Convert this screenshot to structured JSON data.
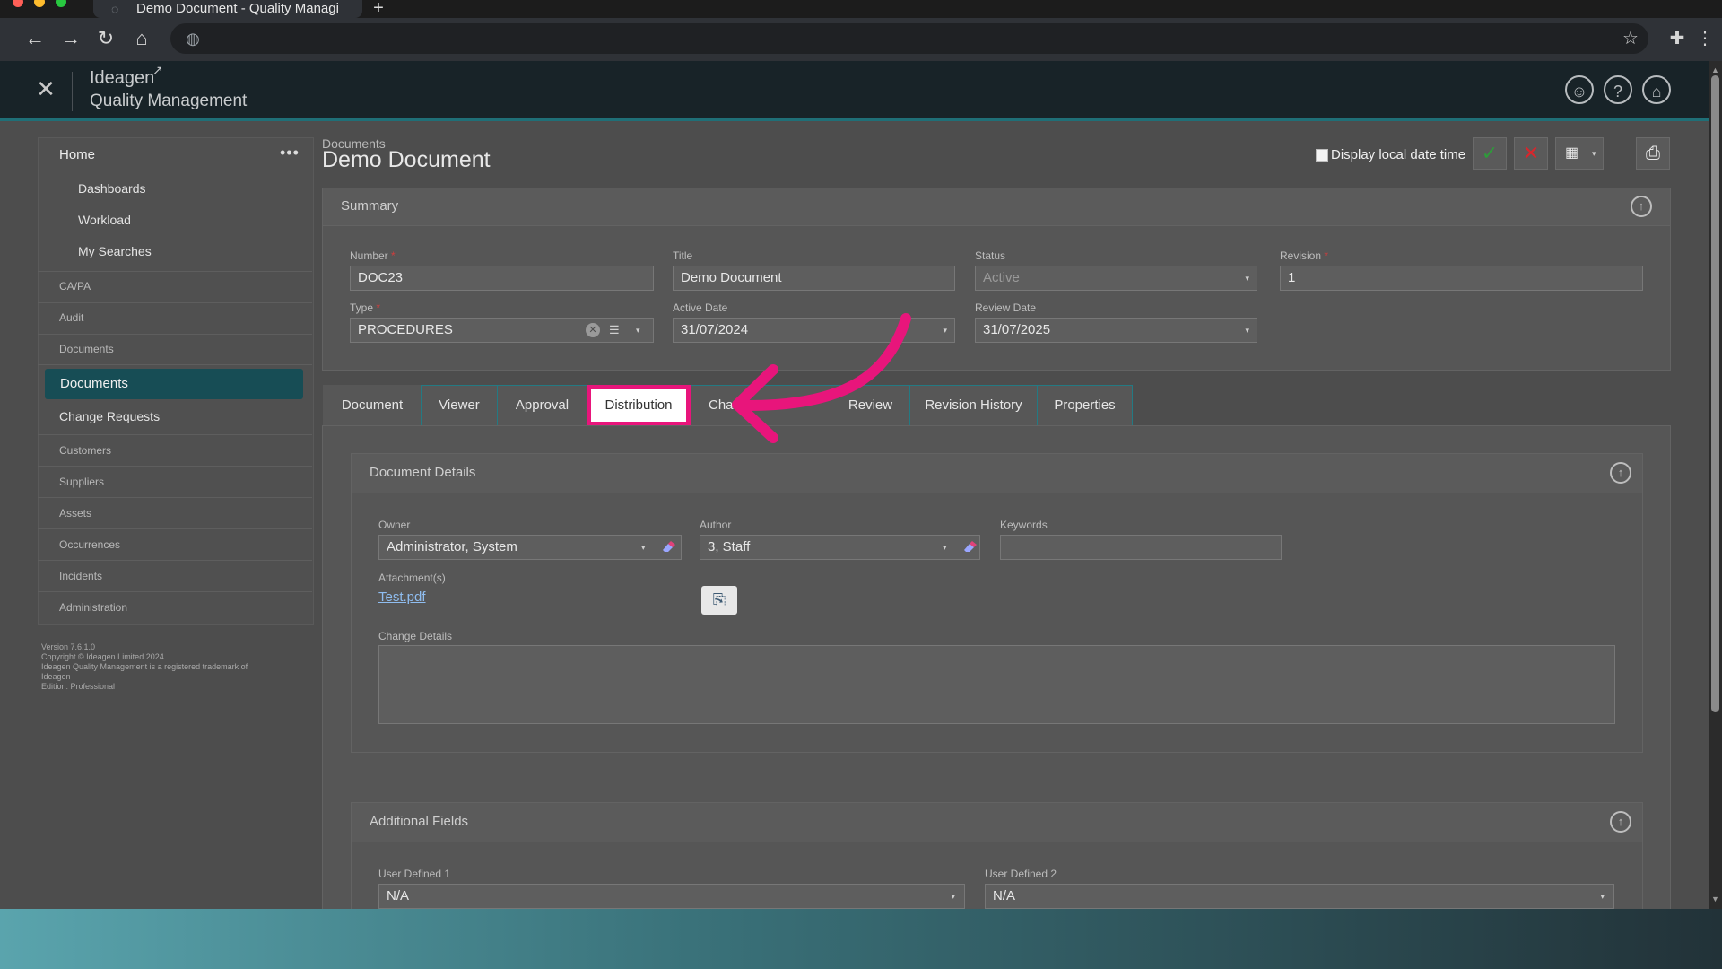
{
  "browser": {
    "tab_title": "Demo Document - Quality Managi",
    "new_tab": "+"
  },
  "app": {
    "brand_line1": "Ideagen",
    "brand_line2": "Quality Management"
  },
  "sidebar": {
    "home": "Home",
    "home_items": [
      "Dashboards",
      "Workload",
      "My Searches"
    ],
    "categories": [
      "CA/PA",
      "Audit",
      "Documents"
    ],
    "documents_active": "Documents",
    "documents_sub": "Change Requests",
    "more_categories": [
      "Customers",
      "Suppliers",
      "Assets",
      "Occurrences",
      "Incidents",
      "Administration"
    ],
    "footer": [
      "Version 7.6.1.0",
      "Copyright © Ideagen Limited 2024",
      "Ideagen Quality Management is a registered trademark of",
      "Ideagen",
      "Edition: Professional"
    ]
  },
  "header": {
    "breadcrumb": "Documents",
    "title": "Demo Document",
    "display_local_label": "Display local date time"
  },
  "summary": {
    "title": "Summary",
    "number_label": "Number",
    "number_value": "DOC23",
    "title_label": "Title",
    "title_value": "Demo Document",
    "status_label": "Status",
    "status_value": "Active",
    "revision_label": "Revision",
    "revision_value": "1",
    "type_label": "Type",
    "type_value": "PROCEDURES",
    "active_date_label": "Active Date",
    "active_date_value": "31/07/2024",
    "review_date_label": "Review Date",
    "review_date_value": "31/07/2025",
    "required_mark": "*"
  },
  "tabs": [
    {
      "label": "Document"
    },
    {
      "label": "Viewer"
    },
    {
      "label": "Approval"
    },
    {
      "label": "Distribution"
    },
    {
      "label": "Cha"
    },
    {
      "label": "Review"
    },
    {
      "label": "Revision History"
    },
    {
      "label": "Properties"
    }
  ],
  "document_details": {
    "title": "Document Details",
    "owner_label": "Owner",
    "owner_value": "Administrator, System",
    "author_label": "Author",
    "author_value": "3, Staff",
    "keywords_label": "Keywords",
    "keywords_value": "",
    "attachments_label": "Attachment(s)",
    "attachment_file": "Test.pdf",
    "change_details_label": "Change Details"
  },
  "additional_fields": {
    "title": "Additional Fields",
    "ud1_label": "User Defined 1",
    "ud1_value": "N/A",
    "ud2_label": "User Defined 2",
    "ud2_value": "N/A"
  },
  "colors": {
    "accent": "#174d55",
    "highlight": "#e8157b"
  }
}
